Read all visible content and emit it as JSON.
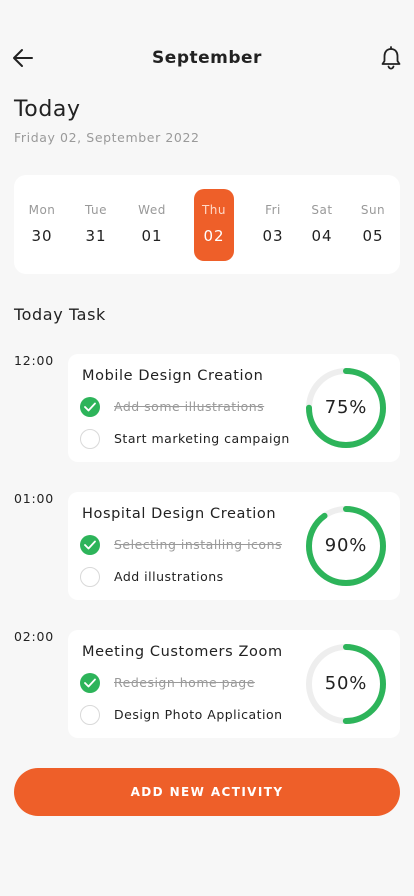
{
  "header": {
    "title": "September",
    "back_icon": "arrow-left-icon",
    "bell_icon": "bell-icon"
  },
  "today": {
    "title": "Today",
    "date": "Friday 02, September 2022"
  },
  "calendar": {
    "days": [
      {
        "name": "Mon",
        "num": "30",
        "active": false
      },
      {
        "name": "Tue",
        "num": "31",
        "active": false
      },
      {
        "name": "Wed",
        "num": "01",
        "active": false
      },
      {
        "name": "Thu",
        "num": "02",
        "active": true
      },
      {
        "name": "Fri",
        "num": "03",
        "active": false
      },
      {
        "name": "Sat",
        "num": "04",
        "active": false
      },
      {
        "name": "Sun",
        "num": "05",
        "active": false
      }
    ]
  },
  "section_title": "Today Task",
  "tasks": [
    {
      "time": "12:00",
      "title": "Mobile Design Creation",
      "subtasks": [
        {
          "label": "Add some illustrations",
          "done": true
        },
        {
          "label": "Start marketing campaign",
          "done": false
        }
      ],
      "progress": 75,
      "progress_label": "75%"
    },
    {
      "time": "01:00",
      "title": "Hospital Design Creation",
      "subtasks": [
        {
          "label": "Selecting installing icons",
          "done": true
        },
        {
          "label": "Add illustrations",
          "done": false
        }
      ],
      "progress": 90,
      "progress_label": "90%"
    },
    {
      "time": "02:00",
      "title": "Meeting Customers Zoom",
      "subtasks": [
        {
          "label": "Redesign home page",
          "done": true
        },
        {
          "label": "Design Photo Application",
          "done": false
        }
      ],
      "progress": 50,
      "progress_label": "50%"
    }
  ],
  "add_button_label": "ADD NEW ACTIVITY",
  "colors": {
    "accent": "#ee5f29",
    "done": "#2db45a",
    "ring_track": "#eeeeee",
    "background": "#f7f7f7"
  }
}
